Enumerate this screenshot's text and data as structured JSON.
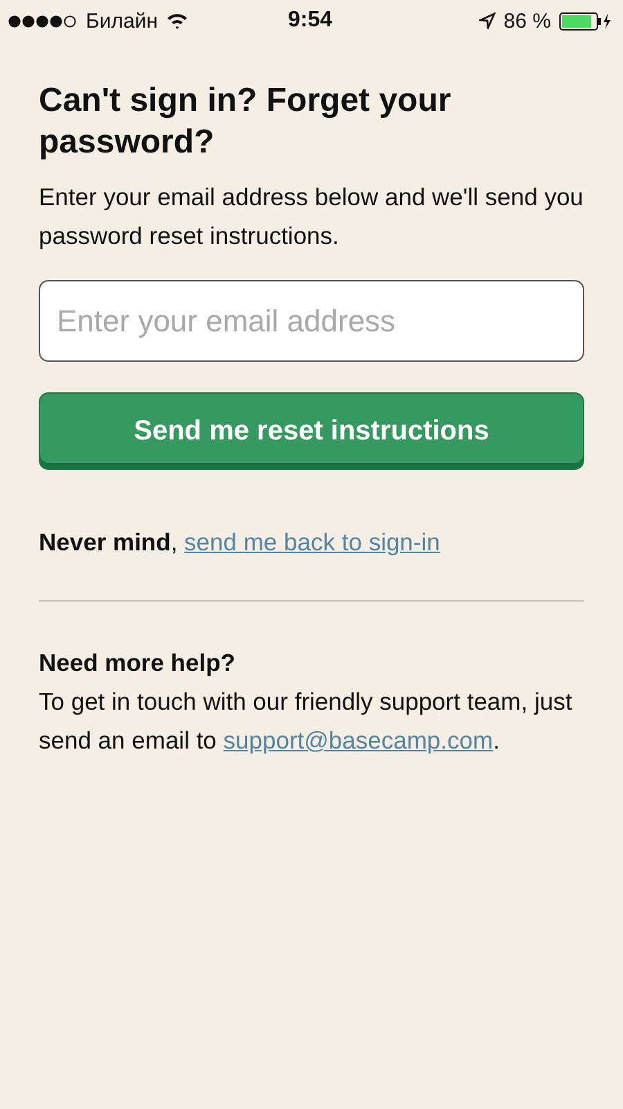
{
  "status_bar": {
    "carrier": "Билайн",
    "time": "9:54",
    "battery": "86 %"
  },
  "title": "Can't sign in? Forget your password?",
  "intro": "Enter your email address below and we'll send you password reset instructions.",
  "email_field": {
    "placeholder": "Enter your email address"
  },
  "submit_button": "Send me reset instructions",
  "back": {
    "prefix": "**Never mind**, ",
    "link": "send me back to sign-in"
  },
  "help": {
    "heading": "Need more help?",
    "text": "To get in touch with our friendly support team, just send an email to ",
    "link": "support@basecamp.com",
    "suffix": "."
  }
}
